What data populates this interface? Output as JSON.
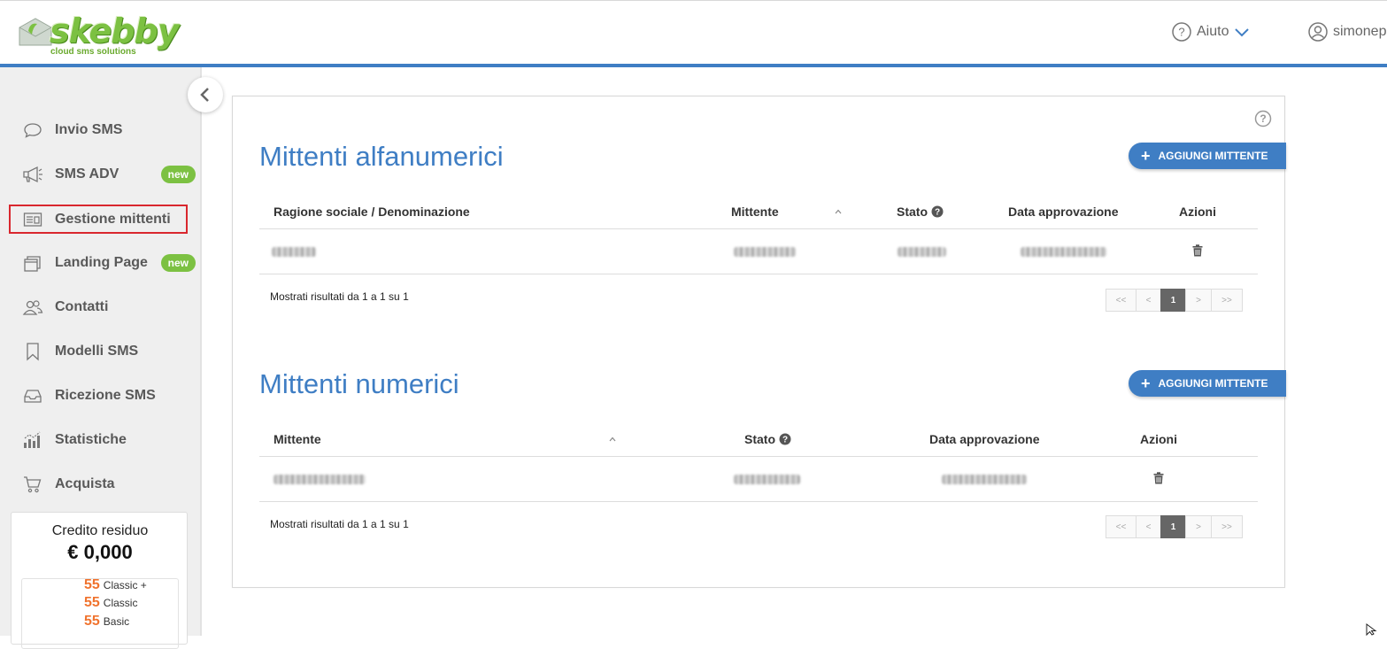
{
  "header": {
    "logo_text": "skebby",
    "logo_tagline": "cloud sms solutions",
    "help_label": "Aiuto",
    "user_label": "simonep"
  },
  "sidebar": {
    "items": [
      {
        "label": "Invio SMS",
        "icon": "chat-bubble-icon",
        "badge": ""
      },
      {
        "label": "SMS ADV",
        "icon": "megaphone-icon",
        "badge": "new"
      },
      {
        "label": "Gestione mittenti",
        "icon": "id-card-icon",
        "badge": "",
        "active": true
      },
      {
        "label": "Landing Page",
        "icon": "layers-icon",
        "badge": "new"
      },
      {
        "label": "Contatti",
        "icon": "contacts-icon",
        "badge": ""
      },
      {
        "label": "Modelli SMS",
        "icon": "bookmark-icon",
        "badge": ""
      },
      {
        "label": "Ricezione SMS",
        "icon": "inbox-icon",
        "badge": ""
      },
      {
        "label": "Statistiche",
        "icon": "bar-chart-icon",
        "badge": ""
      },
      {
        "label": "Acquista",
        "icon": "cart-icon",
        "badge": ""
      }
    ],
    "credit": {
      "title": "Credito residuo",
      "value": "€ 0,000",
      "rows": [
        {
          "num": "55",
          "label": "Classic +"
        },
        {
          "num": "55",
          "label": "Classic"
        },
        {
          "num": "55",
          "label": "Basic"
        }
      ]
    }
  },
  "alfanumerici": {
    "title": "Mittenti alfanumerici",
    "add_button": "AGGIUNGI MITTENTE",
    "columns": [
      "Ragione sociale / Denominazione",
      "Mittente",
      "Stato",
      "Data approvazione",
      "Azioni"
    ],
    "results_text": "Mostrati risultati da 1 a 1 su 1",
    "pager": [
      "<<",
      "<",
      "1",
      ">",
      ">>"
    ]
  },
  "numerici": {
    "title": "Mittenti numerici",
    "add_button": "AGGIUNGI MITTENTE",
    "columns": [
      "Mittente",
      "Stato",
      "Data approvazione",
      "Azioni"
    ],
    "results_text": "Mostrati risultati da 1 a 1 su 1",
    "pager": [
      "<<",
      "<",
      "1",
      ">",
      ">>"
    ]
  },
  "colors": {
    "accent": "#3f7ec4",
    "brand_green": "#7cc142",
    "highlight_border": "#d9272e",
    "credit_orange": "#f0732e"
  }
}
